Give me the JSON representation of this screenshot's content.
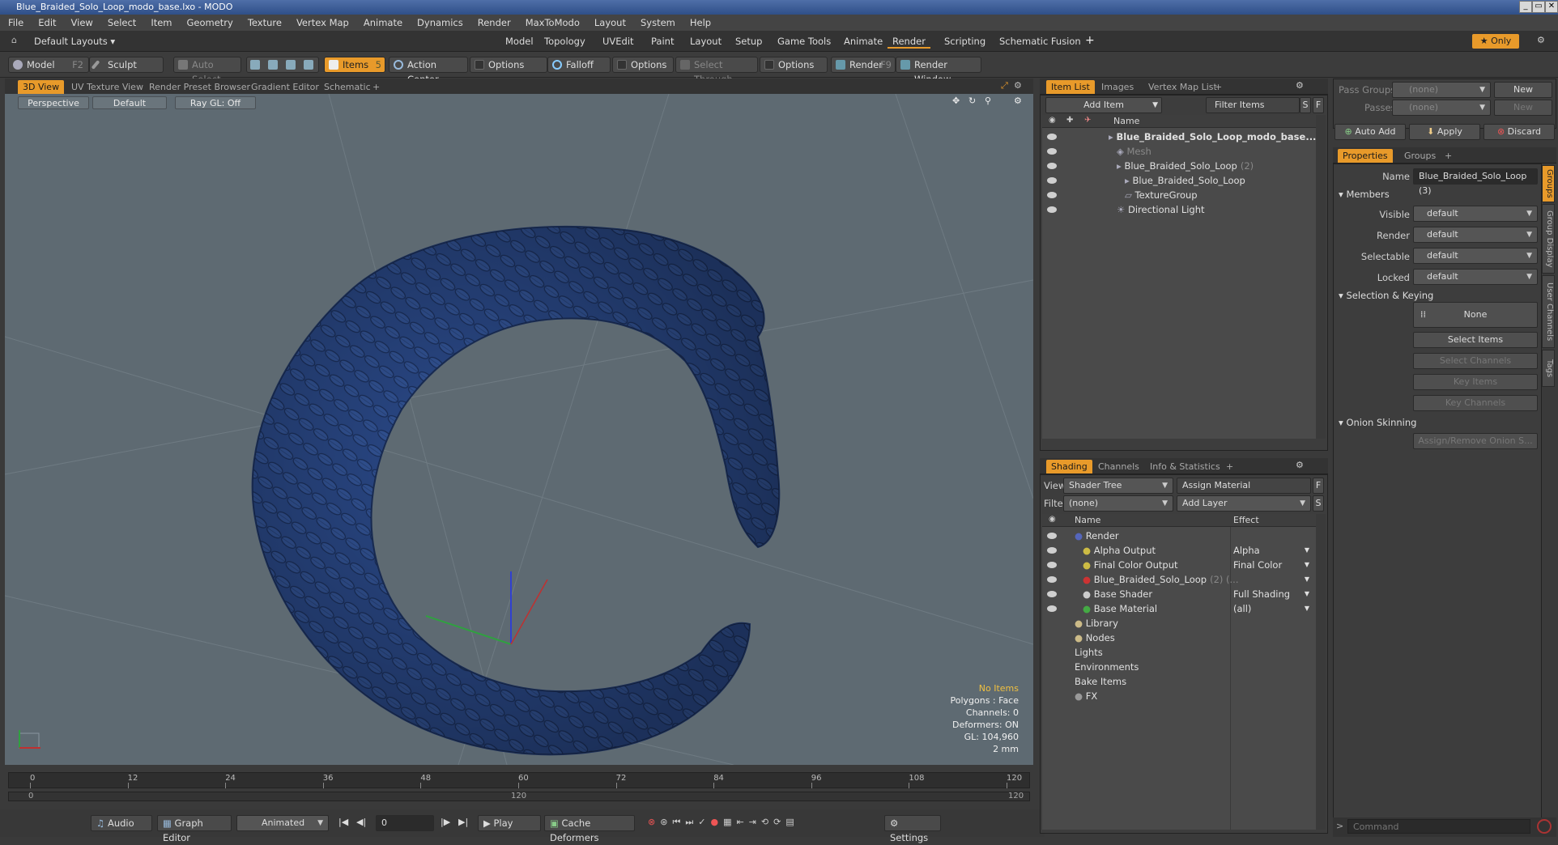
{
  "window": {
    "title": "Blue_Braided_Solo_Loop_modo_base.lxo - MODO"
  },
  "menu": [
    "File",
    "Edit",
    "View",
    "Select",
    "Item",
    "Geometry",
    "Texture",
    "Vertex Map",
    "Animate",
    "Dynamics",
    "Render",
    "MaxToModo",
    "Layout",
    "System",
    "Help"
  ],
  "layouts": {
    "selector": "Default Layouts ▾",
    "tabs": [
      "Model",
      "Topology",
      "UVEdit",
      "Paint",
      "Layout",
      "Setup",
      "Game Tools",
      "Animate",
      "Render",
      "Scripting",
      "Schematic Fusion"
    ],
    "active": "Render",
    "plus": "+",
    "only": "★  Only"
  },
  "toolbar": {
    "model": "Model",
    "model_key": "F2",
    "sculpt": "Sculpt",
    "auto_select": "Auto Select",
    "items": "Items",
    "items_key": "5",
    "action_center": "Action Center",
    "options1": "Options",
    "falloff": "Falloff",
    "options2": "Options",
    "select_through": "Select Through",
    "options3": "Options",
    "render": "Render",
    "render_key": "F9",
    "render_window": "Render Window"
  },
  "viewport_tabs": [
    "3D View",
    "UV Texture View",
    "Render Preset Browser",
    "Gradient Editor",
    "Schematic"
  ],
  "viewport": {
    "perspective": "Perspective",
    "default": "Default",
    "raygl": "Ray GL: Off"
  },
  "hud": {
    "no_items": "No Items",
    "polygons": "Polygons : Face",
    "channels": "Channels: 0",
    "deformers": "Deformers: ON",
    "gl": "GL: 104,960",
    "scale": "2 mm"
  },
  "timeline": {
    "ticks": [
      "0",
      "12",
      "24",
      "36",
      "48",
      "60",
      "72",
      "84",
      "96",
      "108",
      "120"
    ],
    "start": "0",
    "mid": "120",
    "end": "120"
  },
  "bottom": {
    "audio": "Audio",
    "graph_editor": "Graph Editor",
    "animated": "Animated",
    "frame": "0",
    "play": "Play",
    "cache": "Cache Deformers",
    "settings": "Settings"
  },
  "item_list": {
    "tabs": [
      "Item List",
      "Images",
      "Vertex Map List"
    ],
    "add_item": "Add Item",
    "filter": "Filter Items",
    "s": "S",
    "f": "F",
    "col_name": "Name",
    "rows": [
      {
        "label": "Blue_Braided_Solo_Loop_modo_base...",
        "bold": true
      },
      {
        "label": "Mesh",
        "dim": true
      },
      {
        "label": "Blue_Braided_Solo_Loop",
        "suffix": "(2)"
      },
      {
        "label": "Blue_Braided_Solo_Loop"
      },
      {
        "label": "TextureGroup"
      },
      {
        "label": "Directional Light"
      }
    ]
  },
  "shading": {
    "tabs": [
      "Shading",
      "Channels",
      "Info & Statistics"
    ],
    "view_label": "View",
    "view": "Shader Tree",
    "assign": "Assign Material",
    "f": "F",
    "filter_label": "Filter",
    "filter": "(none)",
    "add_layer": "Add Layer",
    "s": "S",
    "col_name": "Name",
    "col_effect": "Effect",
    "rows": [
      {
        "name": "Render",
        "effect": ""
      },
      {
        "name": "Alpha Output",
        "effect": "Alpha"
      },
      {
        "name": "Final Color Output",
        "effect": "Final Color"
      },
      {
        "name": "Blue_Braided_Solo_Loop",
        "suffix": "(2) (...",
        "effect": ""
      },
      {
        "name": "Base Shader",
        "effect": "Full Shading"
      },
      {
        "name": "Base Material",
        "effect": "(all)"
      },
      {
        "name": "Library",
        "effect": ""
      },
      {
        "name": "Nodes",
        "effect": ""
      },
      {
        "name": "Lights",
        "effect": ""
      },
      {
        "name": "Environments",
        "effect": ""
      },
      {
        "name": "Bake Items",
        "effect": ""
      },
      {
        "name": "FX",
        "effect": ""
      }
    ]
  },
  "groups": {
    "pass_groups": "Pass Groups",
    "pass_val": "(none)",
    "new": "New",
    "passes": "Passes",
    "passes_val": "(none)",
    "new2": "New",
    "auto_add": "Auto Add",
    "apply": "Apply",
    "discard": "Discard"
  },
  "properties": {
    "tabs": [
      "Properties",
      "Groups"
    ],
    "name_label": "Name",
    "name_val": "Blue_Braided_Solo_Loop (3)",
    "members": "Members",
    "visible": "Visible",
    "render": "Render",
    "selectable": "Selectable",
    "locked": "Locked",
    "default": "default",
    "sel_keying": "Selection & Keying",
    "none": "None",
    "select_items": "Select Items",
    "select_channels": "Select Channels",
    "key_items": "Key Items",
    "key_channels": "Key Channels",
    "onion": "Onion Skinning",
    "assign_onion": "Assign/Remove Onion S...",
    "side_tabs": [
      "Groups",
      "Group Display",
      "User Channels",
      "Tags"
    ]
  },
  "command": {
    "placeholder": "Command"
  },
  "colors": {
    "accent": "#e89a2a",
    "rope": "#2b4a8a",
    "viewport": "#5e6a72"
  }
}
